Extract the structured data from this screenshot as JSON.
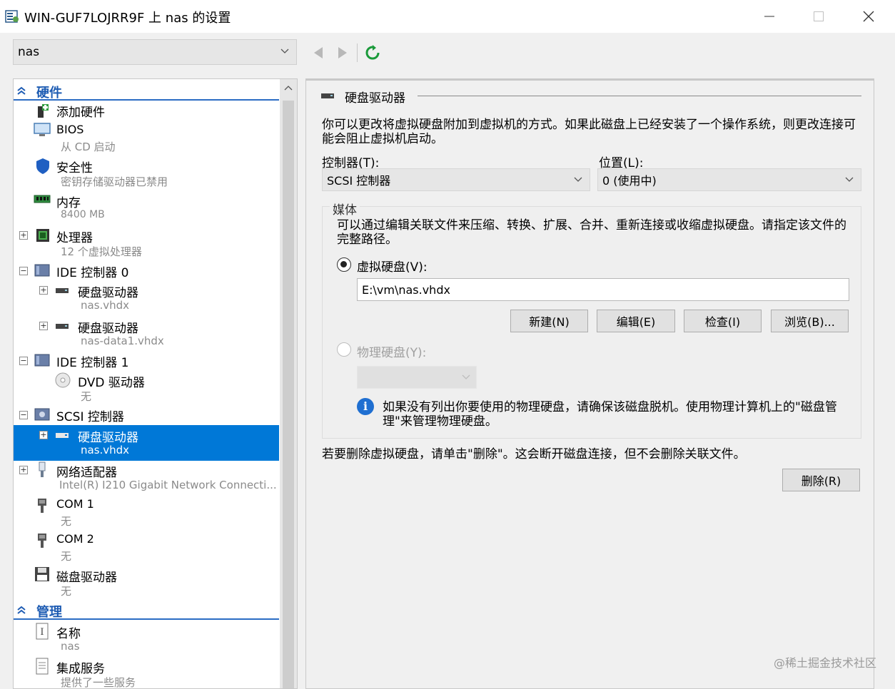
{
  "window": {
    "title": "WIN-GUF7LOJRR9F 上 nas 的设置",
    "minimize_icon": "minimize-icon",
    "maximize_icon": "maximize-icon",
    "close_icon": "close-icon"
  },
  "toolbar": {
    "vm_selected": "nas",
    "back_icon": "back-arrow-icon",
    "forward_icon": "forward-arrow-icon",
    "refresh_icon": "refresh-icon"
  },
  "tree": {
    "hardware_header": "硬件",
    "management_header": "管理",
    "items": [
      {
        "label": "添加硬件",
        "sub": "",
        "icon": "add-hardware-icon"
      },
      {
        "label": "BIOS",
        "sub": "从 CD 启动",
        "icon": "bios-icon"
      },
      {
        "label": "安全性",
        "sub": "密钥存储驱动器已禁用",
        "icon": "shield-icon"
      },
      {
        "label": "内存",
        "sub": "8400 MB",
        "icon": "memory-icon"
      },
      {
        "label": "处理器",
        "sub": "12 个虚拟处理器",
        "icon": "processor-icon"
      },
      {
        "label": "IDE 控制器 0",
        "sub": "",
        "icon": "ide-controller-icon"
      },
      {
        "label": "硬盘驱动器",
        "sub": "nas.vhdx",
        "icon": "hard-drive-icon"
      },
      {
        "label": "硬盘驱动器",
        "sub": "nas-data1.vhdx",
        "icon": "hard-drive-icon"
      },
      {
        "label": "IDE 控制器 1",
        "sub": "",
        "icon": "ide-controller-icon"
      },
      {
        "label": "DVD 驱动器",
        "sub": "无",
        "icon": "dvd-icon"
      },
      {
        "label": "SCSI 控制器",
        "sub": "",
        "icon": "scsi-controller-icon"
      },
      {
        "label": "硬盘驱动器",
        "sub": "nas.vhdx",
        "icon": "hard-drive-icon"
      },
      {
        "label": "网络适配器",
        "sub": "Intel(R) I210 Gigabit Network Connecti...",
        "icon": "network-adapter-icon"
      },
      {
        "label": "COM 1",
        "sub": "无",
        "icon": "com-port-icon"
      },
      {
        "label": "COM 2",
        "sub": "无",
        "icon": "com-port-icon"
      },
      {
        "label": "磁盘驱动器",
        "sub": "无",
        "icon": "floppy-icon"
      },
      {
        "label": "名称",
        "sub": "nas",
        "icon": "name-icon"
      },
      {
        "label": "集成服务",
        "sub": "提供了一些服务",
        "icon": "integration-services-icon"
      }
    ]
  },
  "detail": {
    "title": "硬盘驱动器",
    "description": "你可以更改将虚拟硬盘附加到虚拟机的方式。如果此磁盘上已经安装了一个操作系统，则更改连接可能会阻止虚拟机启动。",
    "controller_label": "控制器(T):",
    "controller_value": "SCSI 控制器",
    "location_label": "位置(L):",
    "location_value": "0 (使用中)",
    "media_title": "媒体",
    "media_description": "可以通过编辑关联文件来压缩、转换、扩展、合并、重新连接或收缩虚拟硬盘。请指定该文件的完整路径。",
    "vhd_label": "虚拟硬盘(V):",
    "vhd_path": "E:\\vm\\nas.vhdx",
    "new_button": "新建(N)",
    "edit_button": "编辑(E)",
    "inspect_button": "检查(I)",
    "browse_button": "浏览(B)...",
    "physical_label": "物理硬盘(Y):",
    "physical_info": "如果没有列出你要使用的物理硬盘，请确保该磁盘脱机。使用物理计算机上的\"磁盘管理\"来管理物理硬盘。",
    "remove_note": "若要删除虚拟硬盘，请单击\"删除\"。这会断开磁盘连接，但不会删除关联文件。",
    "remove_button": "删除(R)"
  },
  "watermark": "@稀土掘金技术社区"
}
